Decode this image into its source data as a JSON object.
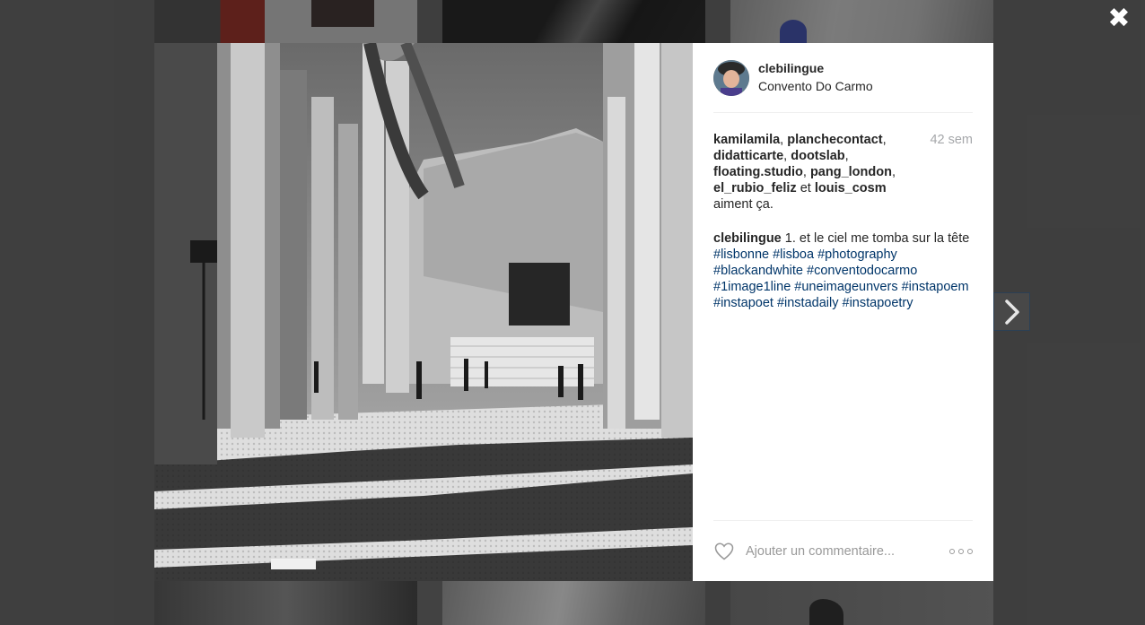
{
  "post": {
    "username": "clebilingue",
    "location": "Convento Do Carmo",
    "time_ago": "42 sem",
    "likers": [
      "kamilamila",
      "planchecontact",
      "didatticarte",
      "dootslab",
      "floating.studio",
      "pang_london",
      "el_rubio_feliz"
    ],
    "likes_last": "louis_cosm",
    "likes_and": "et",
    "likes_suffix": "aiment ça.",
    "caption_text": "1. et le ciel me tomba sur la tête",
    "hashtags": [
      "#lisbonne",
      "#lisboa",
      "#photography",
      "#blackandwhite",
      "#conventodocarmo",
      "#1image1line",
      "#uneimageunvers",
      "#instapoem",
      "#instapoet",
      "#instadaily",
      "#instapoetry"
    ]
  },
  "comment": {
    "placeholder": "Ajouter un commentaire..."
  },
  "icons": {
    "close": "close-icon",
    "next": "chevron-right-icon",
    "like": "heart-icon",
    "more": "more-options-icon"
  },
  "colors": {
    "overlay": "#4b4b4b",
    "hashtag": "#003569",
    "timestamp": "#a5a7aa",
    "text": "#262626"
  }
}
